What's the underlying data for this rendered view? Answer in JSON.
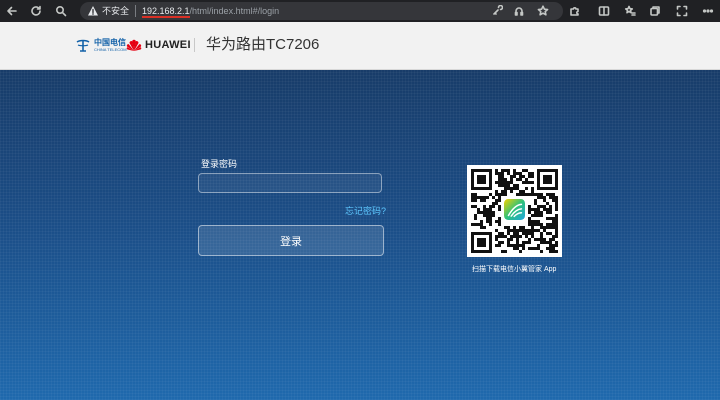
{
  "browser": {
    "security_label": "不安全",
    "url_host": "192.168.2.1",
    "url_path": "/html/index.html#/login"
  },
  "header": {
    "telecom_name_cn": "中国电信",
    "telecom_name_en": "CHINA TELECOM",
    "huawei_name": "HUAWEI",
    "title": "华为路由TC7206"
  },
  "login": {
    "password_label": "登录密码",
    "password_value": "",
    "forgot_label": "忘记密码?",
    "login_button": "登录"
  },
  "qr": {
    "caption": "扫描下载电信小翼管家 App"
  },
  "colors": {
    "header_bg": "#f2f2f2",
    "main_bg_top": "#183c69",
    "main_bg_bottom": "#1f69ad",
    "link": "#5ec8ff",
    "huawei_red": "#e60012",
    "telecom_blue": "#1261a8"
  }
}
